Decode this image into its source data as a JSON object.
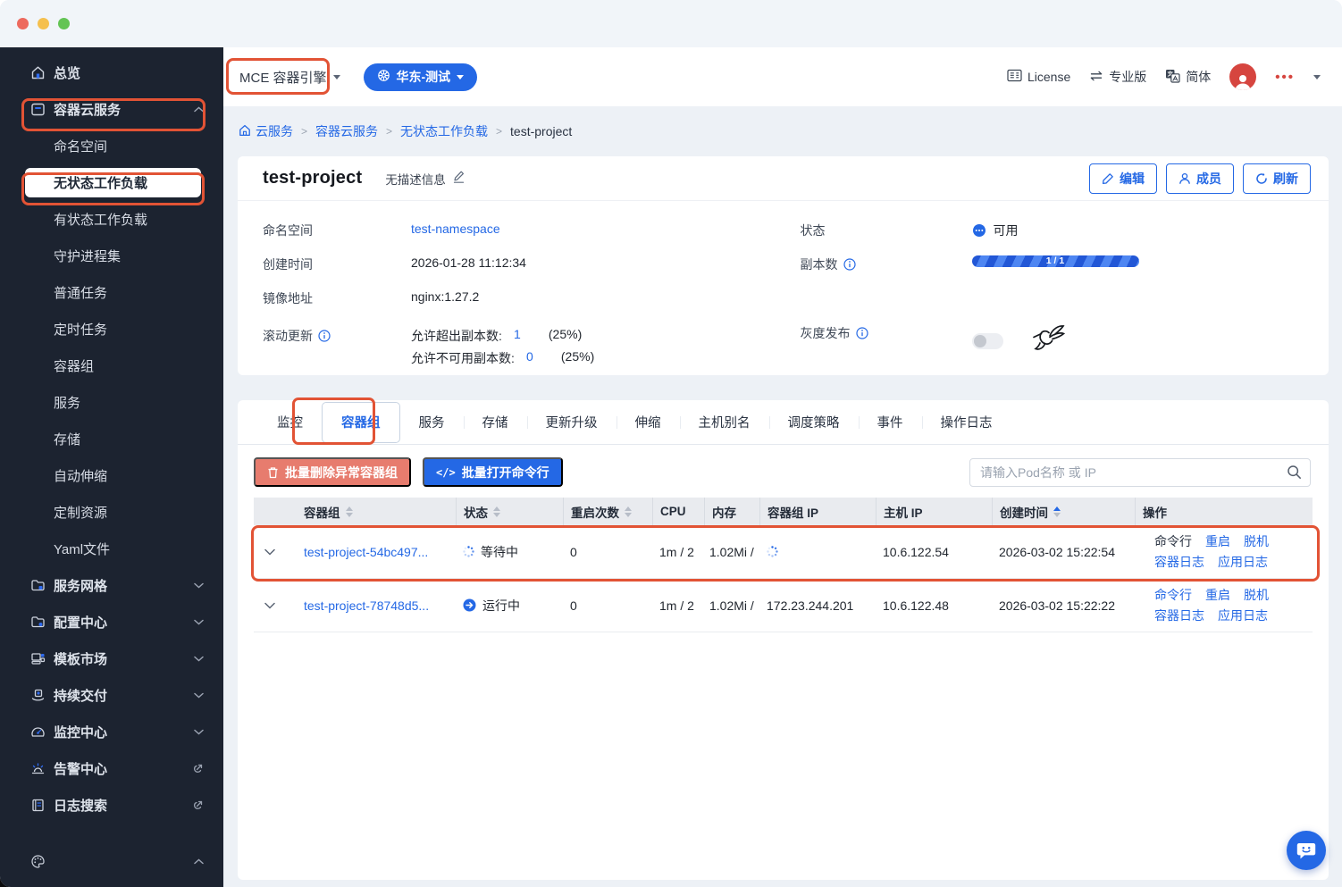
{
  "colors": {
    "accent": "#2468e5",
    "annotation": "#e25335",
    "danger_button": "#e77c6e",
    "avatar_red": "#d6453f",
    "sidebar_bg": "#1c2330"
  },
  "sidebar": {
    "items": [
      {
        "label": "总览",
        "icon": "home-icon"
      },
      {
        "label": "容器云服务",
        "icon": "container-icon",
        "expanded": true,
        "annotated": true
      },
      {
        "label": "命名空间"
      },
      {
        "label": "无状态工作负载",
        "active": true,
        "annotated": true
      },
      {
        "label": "有状态工作负载"
      },
      {
        "label": "守护进程集"
      },
      {
        "label": "普通任务"
      },
      {
        "label": "定时任务"
      },
      {
        "label": "容器组"
      },
      {
        "label": "服务"
      },
      {
        "label": "存储"
      },
      {
        "label": "自动伸缩"
      },
      {
        "label": "定制资源"
      },
      {
        "label": "Yaml文件"
      },
      {
        "label": "服务网格",
        "icon": "mesh-folder-icon",
        "collapsed": true
      },
      {
        "label": "配置中心",
        "icon": "config-folder-icon",
        "collapsed": true
      },
      {
        "label": "模板市场",
        "icon": "template-icon",
        "collapsed": true
      },
      {
        "label": "持续交付",
        "icon": "delivery-icon",
        "collapsed": true
      },
      {
        "label": "监控中心",
        "icon": "monitor-icon",
        "collapsed": true
      },
      {
        "label": "告警中心",
        "icon": "alarm-icon",
        "external": true
      },
      {
        "label": "日志搜索",
        "icon": "log-icon",
        "external": true
      }
    ]
  },
  "topbar": {
    "product_label": "MCE 容器引擎",
    "cluster_label": "华东-测试",
    "license_label": "License",
    "edition_label": "专业版",
    "language_label": "简体"
  },
  "breadcrumb": {
    "items": [
      "云服务",
      "容器云服务",
      "无状态工作负载",
      "test-project"
    ]
  },
  "detail": {
    "title": "test-project",
    "description_placeholder": "无描述信息",
    "edit_button": "编辑",
    "members_button": "成员",
    "refresh_button": "刷新",
    "namespace_label": "命名空间",
    "namespace_value": "test-namespace",
    "created_label": "创建时间",
    "created_value": "2026-01-28 11:12:34",
    "image_label": "镜像地址",
    "image_value": "nginx:1.27.2",
    "rolling_update_label": "滚动更新",
    "max_surge_label": "允许超出副本数:",
    "max_surge_value": "1",
    "max_surge_pct": "(25%)",
    "max_unavailable_label": "允许不可用副本数:",
    "max_unavailable_value": "0",
    "max_unavailable_pct": "(25%)",
    "status_label": "状态",
    "status_value": "可用",
    "replicas_label": "副本数",
    "replicas_value": "1 / 1",
    "gray_release_label": "灰度发布",
    "gray_release_enabled": false
  },
  "tabs": {
    "items": [
      "监控",
      "容器组",
      "服务",
      "存储",
      "更新升级",
      "伸缩",
      "主机别名",
      "调度策略",
      "事件",
      "操作日志"
    ],
    "active": "容器组"
  },
  "toolbar": {
    "batch_delete_label": "批量删除异常容器组",
    "batch_terminal_label": "批量打开命令行",
    "search_placeholder": "请输入Pod名称 或 IP"
  },
  "table": {
    "columns": [
      {
        "label": "容器组",
        "sortable": true
      },
      {
        "label": "状态",
        "sortable": true
      },
      {
        "label": "重启次数",
        "sortable": true
      },
      {
        "label": "CPU",
        "sortable": false
      },
      {
        "label": "内存",
        "sortable": false
      },
      {
        "label": "容器组 IP",
        "sortable": false
      },
      {
        "label": "主机 IP",
        "sortable": false
      },
      {
        "label": "创建时间",
        "sortable": true,
        "sorted": "asc"
      },
      {
        "label": "操作",
        "sortable": false
      }
    ],
    "rows": [
      {
        "name": "test-project-54bc497...",
        "status": "等待中",
        "status_state": "waiting",
        "restarts": "0",
        "cpu": "1m / 2",
        "memory": "1.02Mi /",
        "pod_ip": "",
        "pod_ip_loading": true,
        "host_ip": "10.6.122.54",
        "created": "2026-03-02 15:22:54",
        "annotated": true,
        "actions": {
          "terminal": "命令行",
          "terminal_disabled": true,
          "restart": "重启",
          "offline": "脱机",
          "container_log": "容器日志",
          "app_log": "应用日志"
        }
      },
      {
        "name": "test-project-78748d5...",
        "status": "运行中",
        "status_state": "running",
        "restarts": "0",
        "cpu": "1m / 2",
        "memory": "1.02Mi /",
        "pod_ip": "172.23.244.201",
        "pod_ip_loading": false,
        "host_ip": "10.6.122.48",
        "created": "2026-03-02 15:22:22",
        "annotated": false,
        "actions": {
          "terminal": "命令行",
          "terminal_disabled": false,
          "restart": "重启",
          "offline": "脱机",
          "container_log": "容器日志",
          "app_log": "应用日志"
        }
      }
    ]
  }
}
